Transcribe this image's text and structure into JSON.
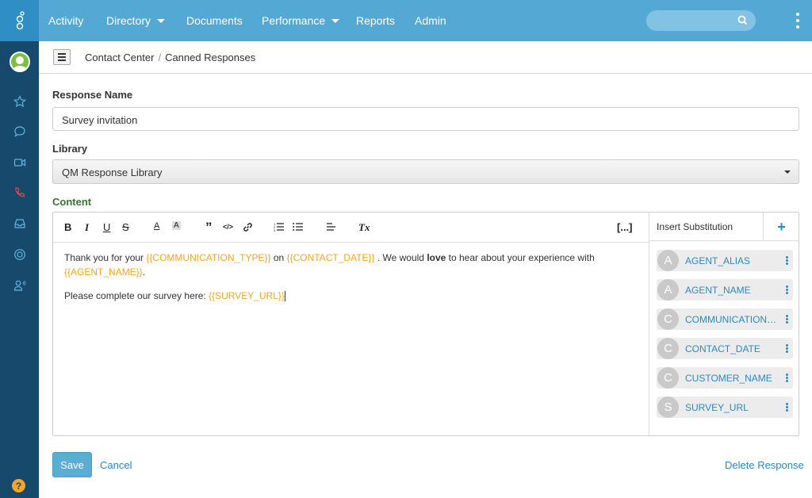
{
  "nav": {
    "items": [
      {
        "label": "Activity",
        "dropdown": false
      },
      {
        "label": "Directory",
        "dropdown": true
      },
      {
        "label": "Documents",
        "dropdown": false
      },
      {
        "label": "Performance",
        "dropdown": true
      },
      {
        "label": "Reports",
        "dropdown": false
      },
      {
        "label": "Admin",
        "dropdown": false
      }
    ],
    "search_value": ""
  },
  "sidebar": {
    "icons": [
      "star-icon",
      "chat-icon",
      "video-icon",
      "phone-icon",
      "inbox-icon",
      "lifebuoy-icon",
      "user-voice-icon"
    ],
    "help_label": "?"
  },
  "breadcrumb": {
    "items": [
      "Contact Center",
      "Canned Responses"
    ],
    "separator": "/"
  },
  "form": {
    "response_name_label": "Response Name",
    "response_name_value": "Survey invitation",
    "library_label": "Library",
    "library_value": "QM Response Library",
    "content_label": "Content"
  },
  "editor": {
    "toolbar": {
      "bold": "B",
      "italic": "I",
      "underline": "U",
      "strike": "S",
      "font_color": "A",
      "highlight": "A",
      "quote": "”",
      "code": "</>",
      "link_icon": "link-icon",
      "ordered_list_icon": "ordered-list-icon",
      "bullet_list_icon": "bullet-list-icon",
      "align_icon": "align-left-icon",
      "clear_format": "Tx",
      "substitution_toggle": "[...]"
    },
    "line1": {
      "t1": "Thank you for your ",
      "s1": "{{COMMUNICATION_TYPE}}",
      "t2": " on ",
      "s2": "{{CONTACT_DATE}}",
      "t3": " . We would ",
      "bold": "love",
      "t4": " to hear about your experience with ",
      "s3": "{{AGENT_NAME}}",
      "t5": "."
    },
    "line2": {
      "t1": "Please complete our survey here: ",
      "s1": "{{SURVEY_URL}}"
    }
  },
  "substitutions": {
    "title": "Insert Substitution",
    "add_label": "+",
    "items": [
      {
        "initial": "A",
        "name": "AGENT_ALIAS"
      },
      {
        "initial": "A",
        "name": "AGENT_NAME"
      },
      {
        "initial": "C",
        "name": "COMMUNICATION_TYPE"
      },
      {
        "initial": "C",
        "name": "CONTACT_DATE"
      },
      {
        "initial": "C",
        "name": "CUSTOMER_NAME"
      },
      {
        "initial": "S",
        "name": "SURVEY_URL"
      }
    ]
  },
  "actions": {
    "save_label": "Save",
    "cancel_label": "Cancel",
    "delete_label": "Delete Response"
  },
  "colors": {
    "topbar": "#53a9d3",
    "rail": "#16496b",
    "accent": "#2a8ac4",
    "substitution": "#f5a623"
  }
}
